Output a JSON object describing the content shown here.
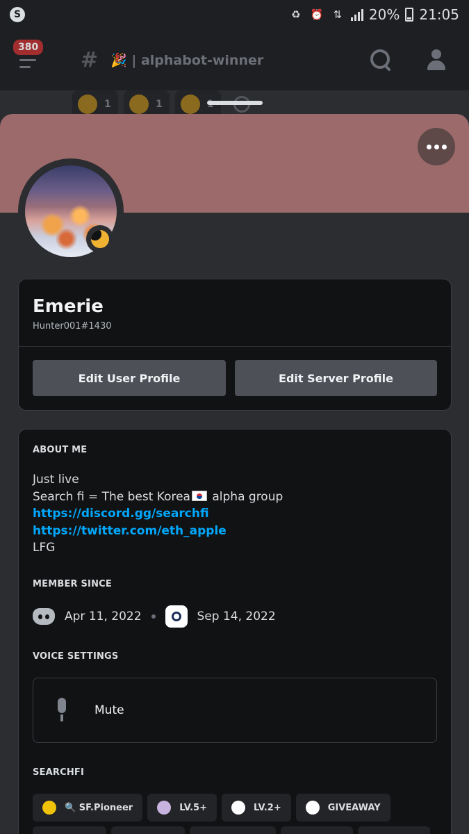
{
  "status_bar": {
    "battery": "20%",
    "time": "21:05"
  },
  "header": {
    "unread_badge": "380",
    "channel_name": "🎉 | alphabot-winner"
  },
  "reactions": [
    {
      "count": "1"
    },
    {
      "count": "1"
    },
    {
      "count": "1"
    }
  ],
  "profile": {
    "display_name": "Emerie",
    "username": "Hunter001#1430",
    "edit_user_label": "Edit User Profile",
    "edit_server_label": "Edit Server Profile"
  },
  "about": {
    "title": "ABOUT ME",
    "line1": "Just live",
    "line2_pre": "Search fi = The best  Korea",
    "line2_post": " alpha group",
    "link1": "https://discord.gg/searchfi",
    "link2": "https://twitter.com/eth_apple",
    "line5": "LFG"
  },
  "member_since": {
    "title": "MEMBER SINCE",
    "discord_date": "Apr 11, 2022",
    "server_date": "Sep 14, 2022"
  },
  "voice": {
    "title": "VOICE SETTINGS",
    "mute_label": "Mute"
  },
  "roles": {
    "title": "SEARCHFI",
    "items": [
      {
        "label": "🔍 SF.Pioneer",
        "color": "#f0c20a"
      },
      {
        "label": "LV.5+",
        "color": "#c7b2e0"
      },
      {
        "label": "LV.2+",
        "color": "#ffffff"
      },
      {
        "label": "GIVEAWAY",
        "color": "#ffffff"
      }
    ]
  },
  "colors": {
    "banner": "#9c6a6a",
    "link": "#00a8fc",
    "button": "#4e5058",
    "status_idle": "#f0b232"
  }
}
